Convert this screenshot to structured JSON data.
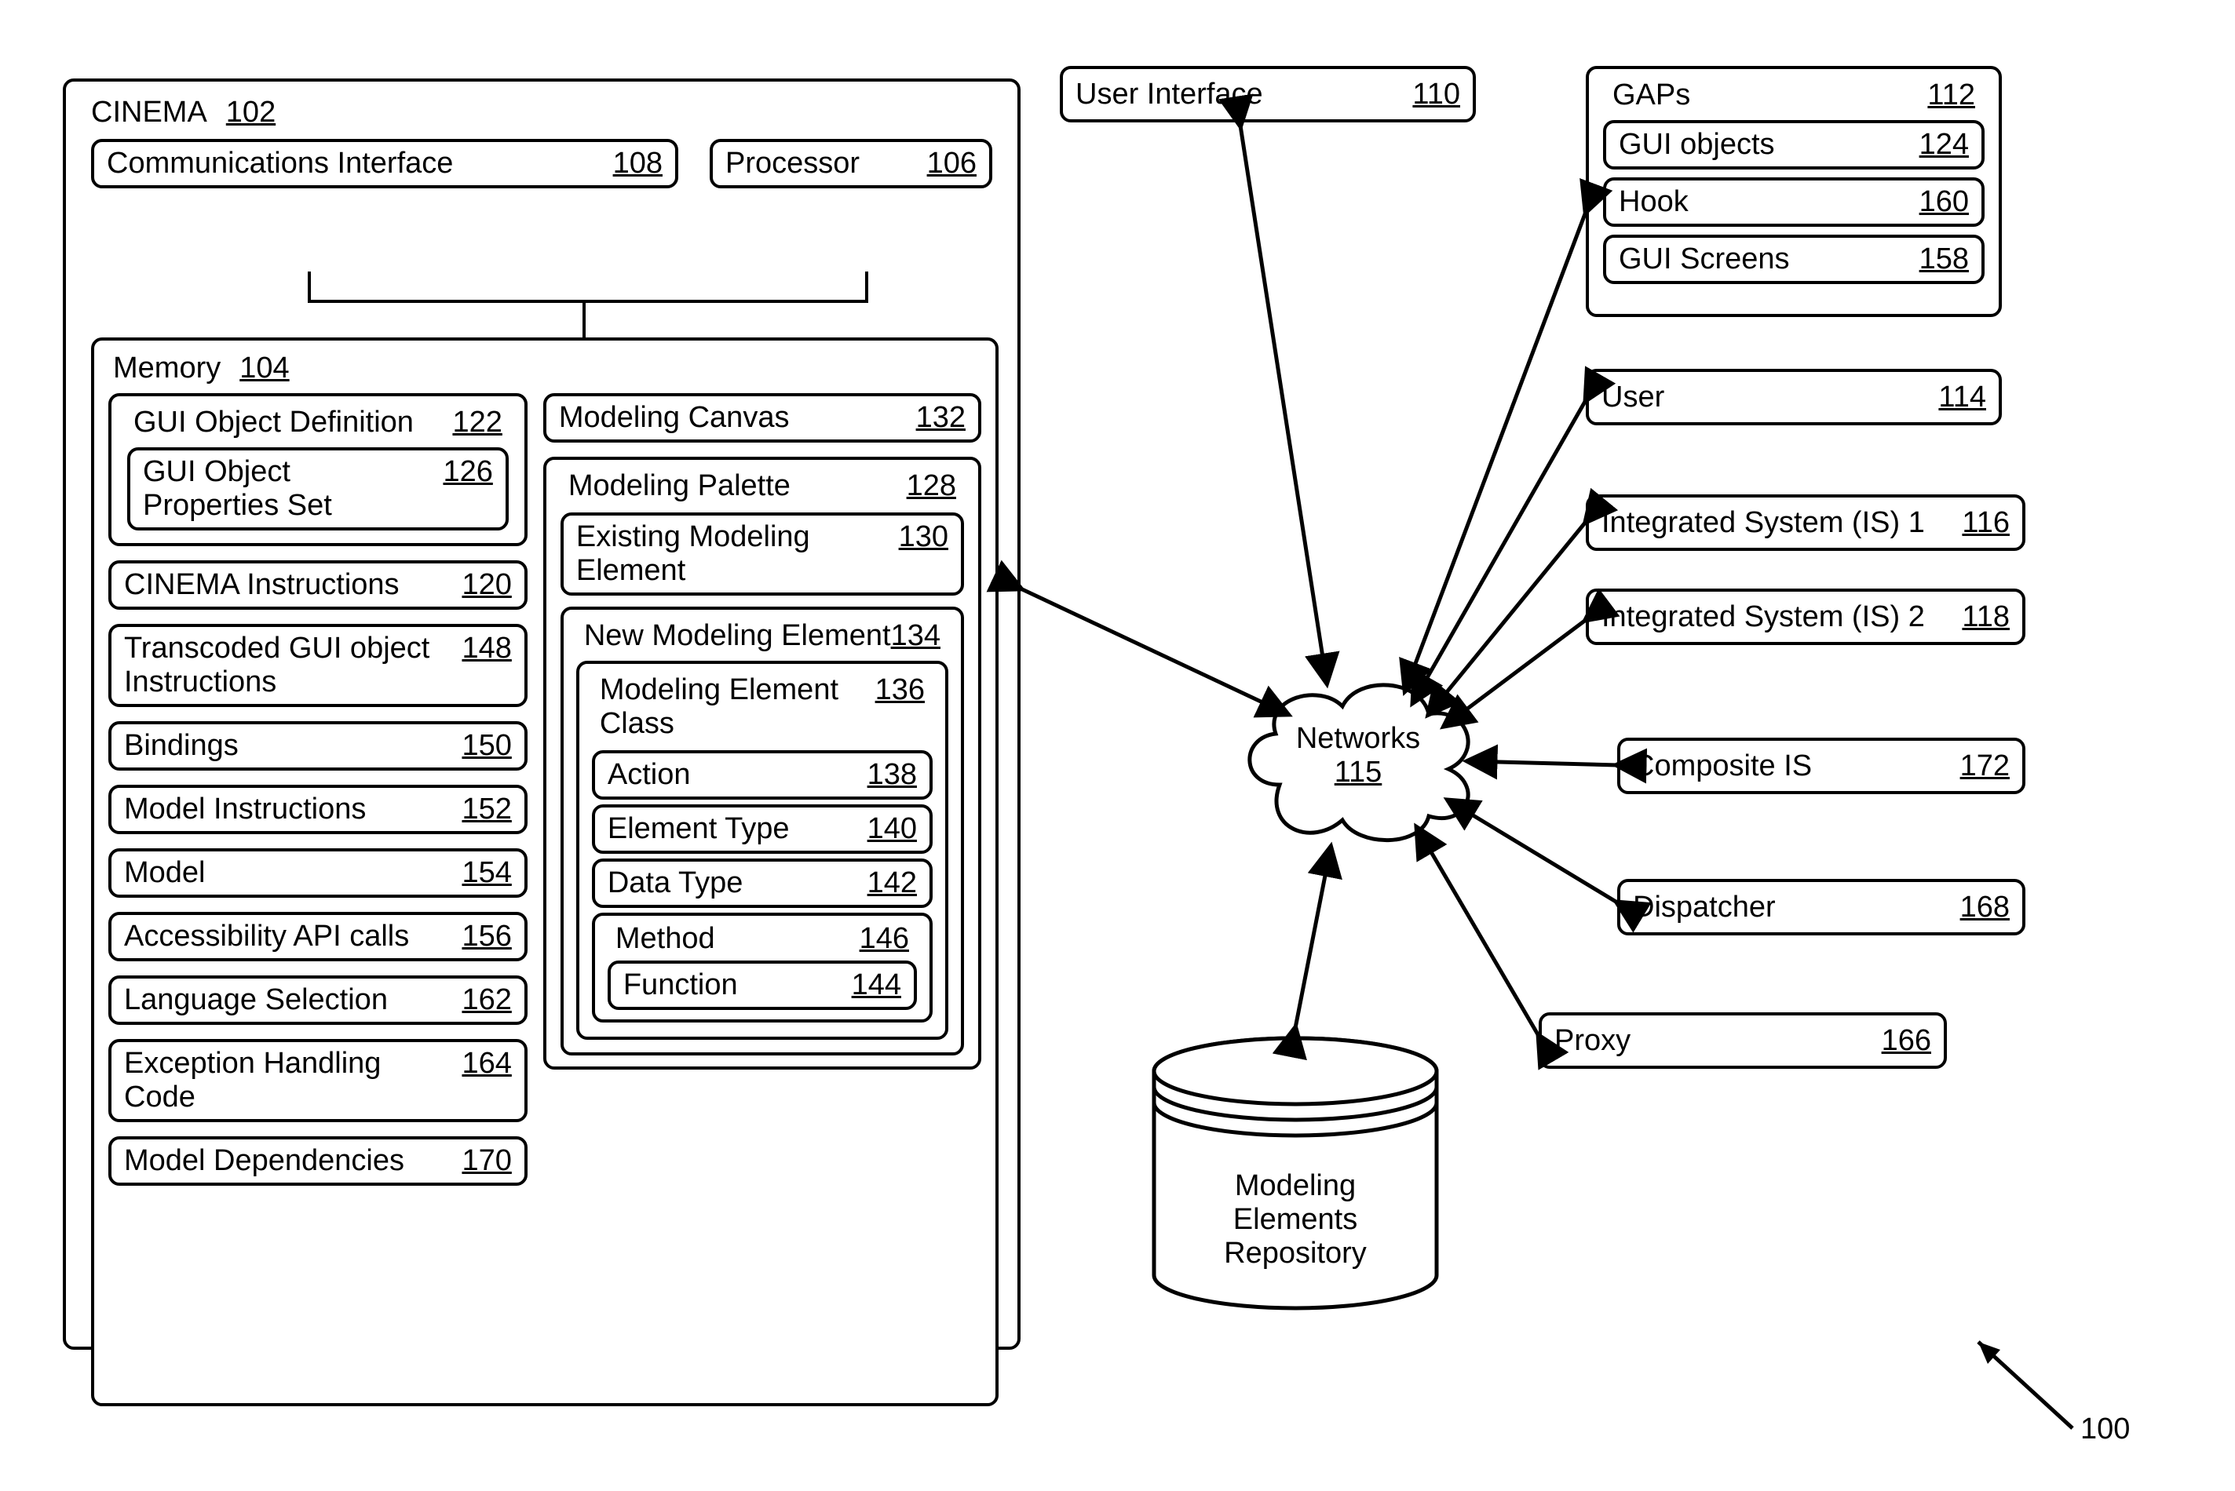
{
  "fig": {
    "num": "100"
  },
  "cinema": {
    "title": "CINEMA",
    "ref": "102",
    "comm": {
      "label": "Communications Interface",
      "ref": "108"
    },
    "proc": {
      "label": "Processor",
      "ref": "106"
    },
    "memory": {
      "title": "Memory",
      "ref": "104",
      "left": {
        "gui_def": {
          "label": "GUI Object Definition",
          "ref": "122"
        },
        "gui_props": {
          "label": "GUI Object Properties Set",
          "ref": "126"
        },
        "instr": {
          "label": "CINEMA Instructions",
          "ref": "120"
        },
        "trans": {
          "label": "Transcoded GUI object Instructions",
          "ref": "148"
        },
        "bind": {
          "label": "Bindings",
          "ref": "150"
        },
        "minstr": {
          "label": "Model Instructions",
          "ref": "152"
        },
        "model": {
          "label": "Model",
          "ref": "154"
        },
        "acc": {
          "label": "Accessibility API calls",
          "ref": "156"
        },
        "lang": {
          "label": "Language Selection",
          "ref": "162"
        },
        "exc": {
          "label": "Exception Handling Code",
          "ref": "164"
        },
        "dep": {
          "label": "Model Dependencies",
          "ref": "170"
        }
      },
      "right": {
        "canvas": {
          "label": "Modeling Canvas",
          "ref": "132"
        },
        "palette": {
          "label": "Modeling Palette",
          "ref": "128"
        },
        "existing": {
          "label": "Existing Modeling Element",
          "ref": "130"
        },
        "newelem": {
          "label": "New Modeling Element",
          "ref": "134"
        },
        "cls": {
          "label": "Modeling Element Class",
          "ref": "136"
        },
        "action": {
          "label": "Action",
          "ref": "138"
        },
        "etype": {
          "label": "Element Type",
          "ref": "140"
        },
        "dtype": {
          "label": "Data Type",
          "ref": "142"
        },
        "method": {
          "label": "Method",
          "ref": "146"
        },
        "func": {
          "label": "Function",
          "ref": "144"
        }
      }
    }
  },
  "right": {
    "ui": {
      "label": "User Interface",
      "ref": "110"
    },
    "gaps": {
      "label": "GAPs",
      "ref": "112",
      "guiobj": {
        "label": "GUI objects",
        "ref": "124"
      },
      "hook": {
        "label": "Hook",
        "ref": "160"
      },
      "screens": {
        "label": "GUI Screens",
        "ref": "158"
      }
    },
    "user": {
      "label": "User",
      "ref": "114"
    },
    "is1": {
      "label": "Integrated System (IS) 1",
      "ref": "116"
    },
    "is2": {
      "label": "Integrated System (IS) 2",
      "ref": "118"
    },
    "comp": {
      "label": "Composite IS",
      "ref": "172"
    },
    "disp": {
      "label": "Dispatcher",
      "ref": "168"
    },
    "proxy": {
      "label": "Proxy",
      "ref": "166"
    },
    "net": {
      "label": "Networks",
      "ref": "115"
    },
    "repo": {
      "label": "Modeling Elements Repository"
    }
  }
}
